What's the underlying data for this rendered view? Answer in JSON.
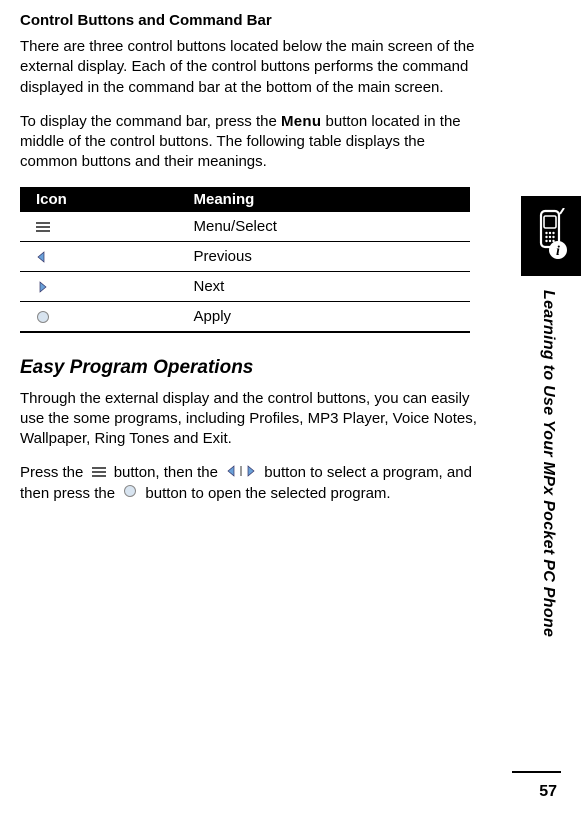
{
  "subsection_title": "Control Buttons and Command Bar",
  "para1": "There are three control buttons located below the main screen of the external display. Each of the control buttons performs the command displayed in the command bar at the bottom of the main screen.",
  "para2_a": "To display the command bar, press the ",
  "para2_menu": "Menu",
  "para2_b": " button located in the middle of the control buttons. The following table displays the common buttons and their meanings.",
  "table": {
    "header_icon": "Icon",
    "header_meaning": "Meaning",
    "rows": [
      {
        "meaning": "Menu/Select"
      },
      {
        "meaning": "Previous"
      },
      {
        "meaning": "Next"
      },
      {
        "meaning": "Apply"
      }
    ]
  },
  "section_heading": "Easy Program Operations",
  "para3": "Through the external display and the control buttons, you can easily use the some programs, including Profiles, MP3 Player, Voice Notes, Wallpaper, Ring Tones and Exit.",
  "para4_a": "Press the ",
  "para4_b": " button, then the ",
  "para4_c": " button to select a program, and then press the ",
  "para4_d": " button to open the selected program.",
  "sidebar_text": "Learning to Use Your MPx Pocket PC Phone",
  "page_number": "57"
}
